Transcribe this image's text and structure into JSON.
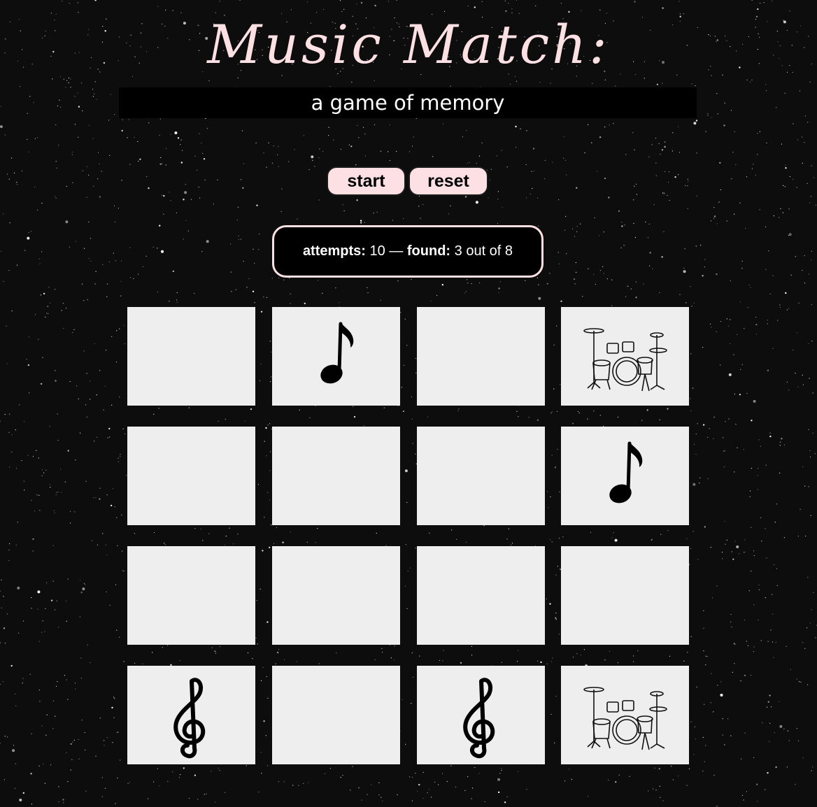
{
  "header": {
    "title": "Music Match:",
    "subtitle": "a game of memory"
  },
  "controls": {
    "start_label": "start",
    "reset_label": "reset"
  },
  "score": {
    "attempts_label": "attempts:",
    "attempts_value": "10",
    "separator": "—",
    "found_label": "found:",
    "found_value": "3 out of 8"
  },
  "board": {
    "columns": 4,
    "rows": 4,
    "cards": [
      {
        "face": "hidden"
      },
      {
        "face": "quarter-note"
      },
      {
        "face": "hidden"
      },
      {
        "face": "drum-kit"
      },
      {
        "face": "hidden"
      },
      {
        "face": "hidden"
      },
      {
        "face": "hidden"
      },
      {
        "face": "quarter-note"
      },
      {
        "face": "hidden"
      },
      {
        "face": "hidden"
      },
      {
        "face": "hidden"
      },
      {
        "face": "hidden"
      },
      {
        "face": "treble-clef"
      },
      {
        "face": "hidden"
      },
      {
        "face": "treble-clef"
      },
      {
        "face": "drum-kit"
      }
    ]
  },
  "colors": {
    "accent_pink": "#fde0e4",
    "card_back": "#eeeeee",
    "background": "#0d0d0d"
  }
}
